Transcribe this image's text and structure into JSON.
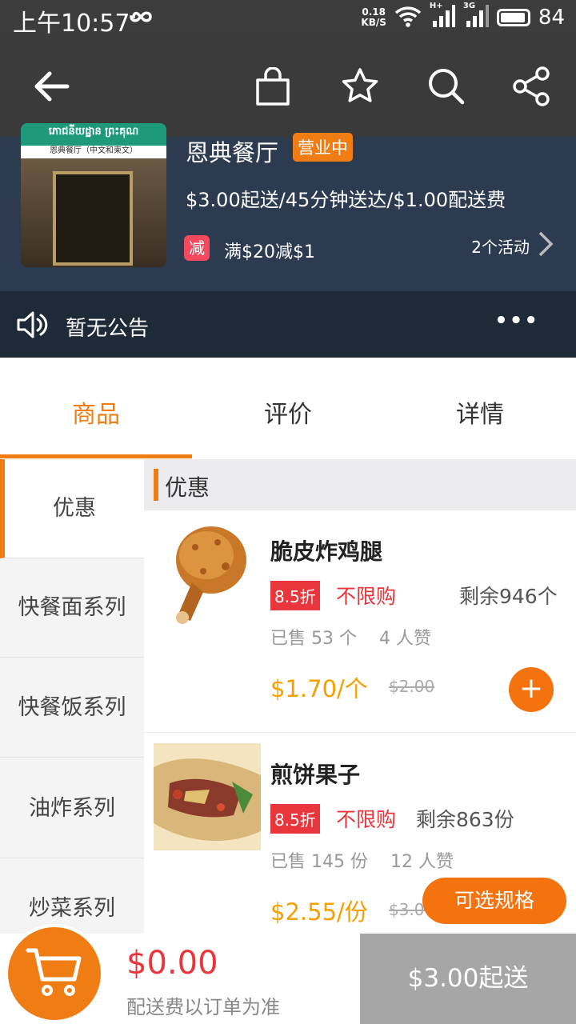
{
  "status_bar": {
    "time": "上午10:57",
    "net_speed_value": "0.18",
    "net_speed_unit": "KB/S",
    "signal_1_label": "H+",
    "signal_2_label": "3G",
    "battery": "84"
  },
  "toolbar": {
    "back_icon": "arrow-left-icon",
    "bag_icon": "shopping-bag-icon",
    "favorite_icon": "star-icon",
    "search_icon": "search-icon",
    "share_icon": "share-icon"
  },
  "store": {
    "name": "恩典餐厅",
    "status_badge": "营业中",
    "delivery_info": "$3.00起送/45分钟送达/$1.00配送费",
    "promo_tag": "减",
    "promo_text": "满$20减$1",
    "activities": "2个活动"
  },
  "notice": {
    "text": "暂无公告",
    "more": "•••"
  },
  "tabs": [
    {
      "label": "商品",
      "active": true
    },
    {
      "label": "评价",
      "active": false
    },
    {
      "label": "详情",
      "active": false
    }
  ],
  "categories": [
    {
      "label": "优惠",
      "active": true
    },
    {
      "label": "快餐面系列",
      "active": false
    },
    {
      "label": "快餐饭系列",
      "active": false
    },
    {
      "label": "油炸系列",
      "active": false
    },
    {
      "label": "炒菜系列",
      "active": false
    }
  ],
  "section": {
    "title": "优惠"
  },
  "products": [
    {
      "name": "脆皮炸鸡腿",
      "discount": "8.5折",
      "limit": "不限购",
      "stock": "剩余946个",
      "sold": "已售 53 个",
      "likes": "4 人赞",
      "price": "$1.70/个",
      "old_price": "$2.00",
      "action": "+"
    },
    {
      "name": "煎饼果子",
      "discount": "8.5折",
      "limit": "不限购",
      "stock": "剩余863份",
      "sold": "已售 145 份",
      "likes": "12 人赞",
      "price": "$2.55/份",
      "old_price": "$3.00",
      "action": "可选规格"
    }
  ],
  "cart": {
    "total": "$0.00",
    "fee_note": "配送费以订单为准",
    "checkout": "$3.00起送"
  },
  "colors": {
    "accent": "#f07d14",
    "price": "#f5a000",
    "discount_red": "#e8363c",
    "header_dark": "#2d3b50"
  }
}
